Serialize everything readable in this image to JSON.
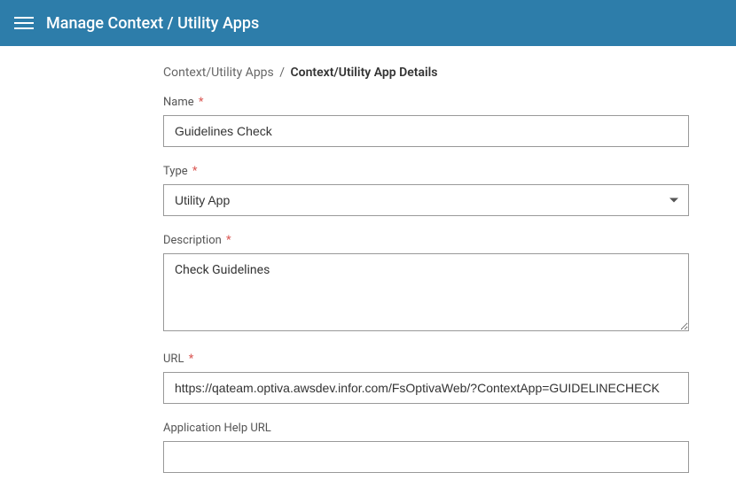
{
  "header": {
    "title": "Manage Context / Utility Apps"
  },
  "breadcrumb": {
    "parent": "Context/Utility Apps",
    "separator": "/",
    "current": "Context/Utility App Details"
  },
  "form": {
    "name_label": "Name",
    "name_value": "Guidelines Check",
    "type_label": "Type",
    "type_value": "Utility App",
    "description_label": "Description",
    "description_value": "Check Guidelines",
    "url_label": "URL",
    "url_value": "https://qateam.optiva.awsdev.infor.com/FsOptivaWeb/?ContextApp=GUIDELINECHECK",
    "help_url_label": "Application Help URL",
    "help_url_value": "",
    "required_mark": "*"
  }
}
